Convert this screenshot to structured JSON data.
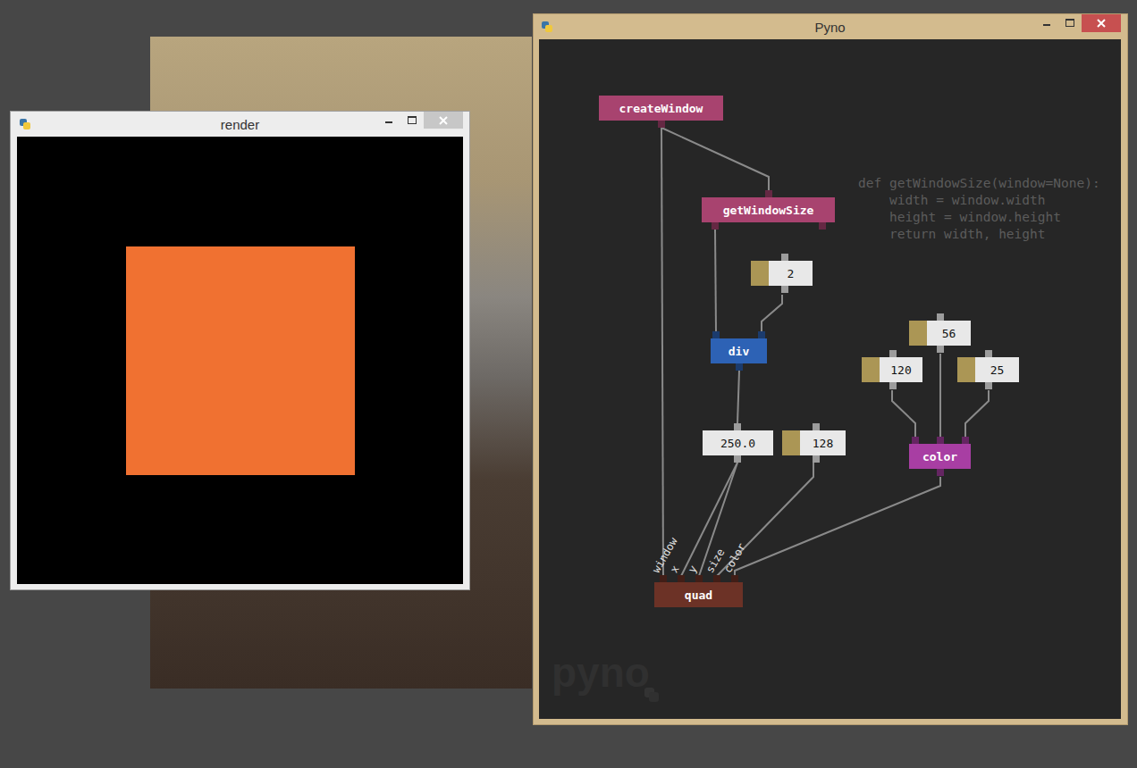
{
  "render_window": {
    "title": "render"
  },
  "pyno_window": {
    "title": "Pyno",
    "watermark": "pyno",
    "code": [
      "def getWindowSize(window=None):",
      "    width = window.width",
      "    height = window.height",
      "    return width, height"
    ],
    "nodes": [
      {
        "label": "createWindow",
        "kind": "function",
        "color": "#a8436f"
      },
      {
        "label": "getWindowSize",
        "kind": "function",
        "color": "#a8436f"
      },
      {
        "label": "2",
        "kind": "number",
        "color": "#ab9655"
      },
      {
        "label": "div",
        "kind": "function",
        "color": "#2d62b5"
      },
      {
        "label": "250.0",
        "kind": "value",
        "color": "#e8e8e8"
      },
      {
        "label": "128",
        "kind": "number",
        "color": "#ab9655"
      },
      {
        "label": "56",
        "kind": "number",
        "color": "#ab9655"
      },
      {
        "label": "120",
        "kind": "number",
        "color": "#ab9655"
      },
      {
        "label": "25",
        "kind": "number",
        "color": "#ab9655"
      },
      {
        "label": "color",
        "kind": "function",
        "color": "#a83ea3"
      },
      {
        "label": "quad",
        "kind": "function",
        "color": "#6c3226",
        "inputs": [
          "window",
          "x",
          "y",
          "size",
          "color"
        ]
      }
    ]
  }
}
